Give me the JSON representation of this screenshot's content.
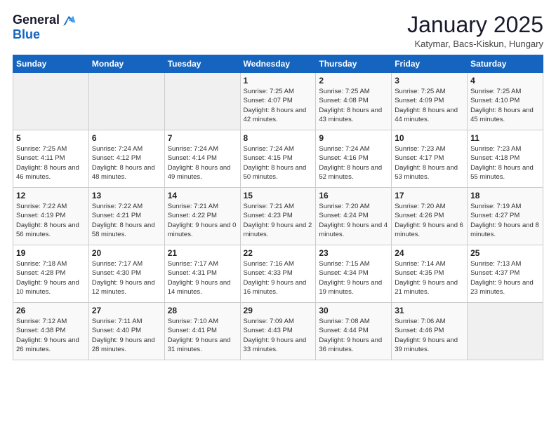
{
  "header": {
    "logo_line1": "General",
    "logo_line2": "Blue",
    "month_title": "January 2025",
    "location": "Katymar, Bacs-Kiskun, Hungary"
  },
  "days_of_week": [
    "Sunday",
    "Monday",
    "Tuesday",
    "Wednesday",
    "Thursday",
    "Friday",
    "Saturday"
  ],
  "weeks": [
    [
      {
        "day": "",
        "info": ""
      },
      {
        "day": "",
        "info": ""
      },
      {
        "day": "",
        "info": ""
      },
      {
        "day": "1",
        "info": "Sunrise: 7:25 AM\nSunset: 4:07 PM\nDaylight: 8 hours and 42 minutes."
      },
      {
        "day": "2",
        "info": "Sunrise: 7:25 AM\nSunset: 4:08 PM\nDaylight: 8 hours and 43 minutes."
      },
      {
        "day": "3",
        "info": "Sunrise: 7:25 AM\nSunset: 4:09 PM\nDaylight: 8 hours and 44 minutes."
      },
      {
        "day": "4",
        "info": "Sunrise: 7:25 AM\nSunset: 4:10 PM\nDaylight: 8 hours and 45 minutes."
      }
    ],
    [
      {
        "day": "5",
        "info": "Sunrise: 7:25 AM\nSunset: 4:11 PM\nDaylight: 8 hours and 46 minutes."
      },
      {
        "day": "6",
        "info": "Sunrise: 7:24 AM\nSunset: 4:12 PM\nDaylight: 8 hours and 48 minutes."
      },
      {
        "day": "7",
        "info": "Sunrise: 7:24 AM\nSunset: 4:14 PM\nDaylight: 8 hours and 49 minutes."
      },
      {
        "day": "8",
        "info": "Sunrise: 7:24 AM\nSunset: 4:15 PM\nDaylight: 8 hours and 50 minutes."
      },
      {
        "day": "9",
        "info": "Sunrise: 7:24 AM\nSunset: 4:16 PM\nDaylight: 8 hours and 52 minutes."
      },
      {
        "day": "10",
        "info": "Sunrise: 7:23 AM\nSunset: 4:17 PM\nDaylight: 8 hours and 53 minutes."
      },
      {
        "day": "11",
        "info": "Sunrise: 7:23 AM\nSunset: 4:18 PM\nDaylight: 8 hours and 55 minutes."
      }
    ],
    [
      {
        "day": "12",
        "info": "Sunrise: 7:22 AM\nSunset: 4:19 PM\nDaylight: 8 hours and 56 minutes."
      },
      {
        "day": "13",
        "info": "Sunrise: 7:22 AM\nSunset: 4:21 PM\nDaylight: 8 hours and 58 minutes."
      },
      {
        "day": "14",
        "info": "Sunrise: 7:21 AM\nSunset: 4:22 PM\nDaylight: 9 hours and 0 minutes."
      },
      {
        "day": "15",
        "info": "Sunrise: 7:21 AM\nSunset: 4:23 PM\nDaylight: 9 hours and 2 minutes."
      },
      {
        "day": "16",
        "info": "Sunrise: 7:20 AM\nSunset: 4:24 PM\nDaylight: 9 hours and 4 minutes."
      },
      {
        "day": "17",
        "info": "Sunrise: 7:20 AM\nSunset: 4:26 PM\nDaylight: 9 hours and 6 minutes."
      },
      {
        "day": "18",
        "info": "Sunrise: 7:19 AM\nSunset: 4:27 PM\nDaylight: 9 hours and 8 minutes."
      }
    ],
    [
      {
        "day": "19",
        "info": "Sunrise: 7:18 AM\nSunset: 4:28 PM\nDaylight: 9 hours and 10 minutes."
      },
      {
        "day": "20",
        "info": "Sunrise: 7:17 AM\nSunset: 4:30 PM\nDaylight: 9 hours and 12 minutes."
      },
      {
        "day": "21",
        "info": "Sunrise: 7:17 AM\nSunset: 4:31 PM\nDaylight: 9 hours and 14 minutes."
      },
      {
        "day": "22",
        "info": "Sunrise: 7:16 AM\nSunset: 4:33 PM\nDaylight: 9 hours and 16 minutes."
      },
      {
        "day": "23",
        "info": "Sunrise: 7:15 AM\nSunset: 4:34 PM\nDaylight: 9 hours and 19 minutes."
      },
      {
        "day": "24",
        "info": "Sunrise: 7:14 AM\nSunset: 4:35 PM\nDaylight: 9 hours and 21 minutes."
      },
      {
        "day": "25",
        "info": "Sunrise: 7:13 AM\nSunset: 4:37 PM\nDaylight: 9 hours and 23 minutes."
      }
    ],
    [
      {
        "day": "26",
        "info": "Sunrise: 7:12 AM\nSunset: 4:38 PM\nDaylight: 9 hours and 26 minutes."
      },
      {
        "day": "27",
        "info": "Sunrise: 7:11 AM\nSunset: 4:40 PM\nDaylight: 9 hours and 28 minutes."
      },
      {
        "day": "28",
        "info": "Sunrise: 7:10 AM\nSunset: 4:41 PM\nDaylight: 9 hours and 31 minutes."
      },
      {
        "day": "29",
        "info": "Sunrise: 7:09 AM\nSunset: 4:43 PM\nDaylight: 9 hours and 33 minutes."
      },
      {
        "day": "30",
        "info": "Sunrise: 7:08 AM\nSunset: 4:44 PM\nDaylight: 9 hours and 36 minutes."
      },
      {
        "day": "31",
        "info": "Sunrise: 7:06 AM\nSunset: 4:46 PM\nDaylight: 9 hours and 39 minutes."
      },
      {
        "day": "",
        "info": ""
      }
    ]
  ]
}
